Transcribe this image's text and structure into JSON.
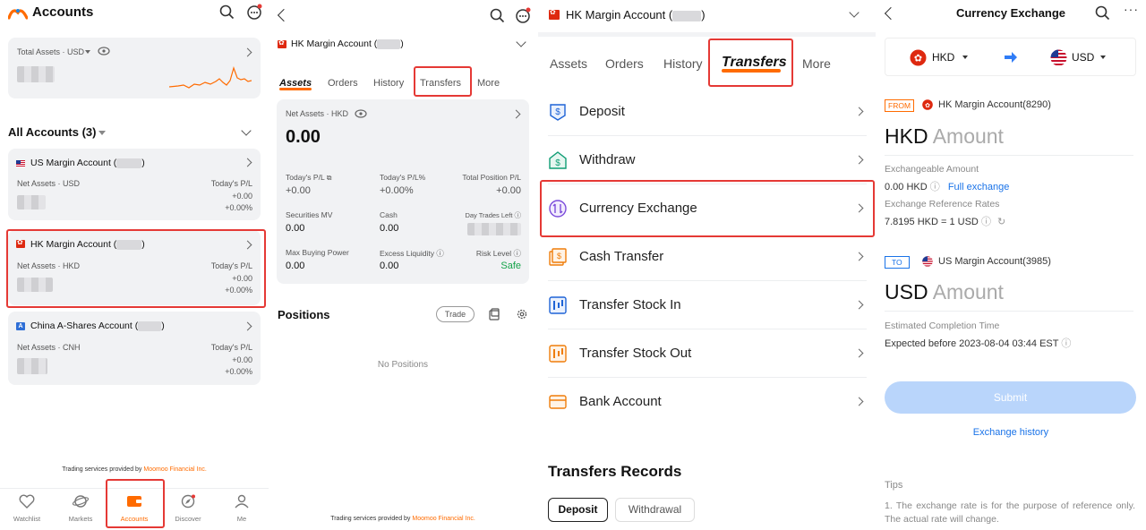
{
  "panel1": {
    "title": "Accounts",
    "total_assets_label": "Total Assets · USD",
    "all_accounts_label": "All Accounts (3)",
    "accounts": [
      {
        "name": "US Margin Account (",
        "close": ")",
        "net_label": "Net Assets · USD",
        "pl_label": "Today's P/L",
        "pl_value": "+0.00",
        "pl_pct": "+0.00%"
      },
      {
        "name": "HK Margin Account (",
        "close": ")",
        "net_label": "Net Assets · HKD",
        "pl_label": "Today's P/L",
        "pl_value": "+0.00",
        "pl_pct": "+0.00%"
      },
      {
        "name": "China A-Shares Account (",
        "close": ")",
        "net_label": "Net Assets · CNH",
        "pl_label": "Today's P/L",
        "pl_value": "+0.00",
        "pl_pct": "+0.00%"
      }
    ],
    "footer_prefix": "Trading services provided by ",
    "footer_brand": "Moomoo Financial Inc.",
    "nav": [
      "Watchlist",
      "Markets",
      "Accounts",
      "Discover",
      "Me"
    ]
  },
  "panel2": {
    "account_name": "HK Margin Account (",
    "account_close": ")",
    "tabs": [
      "Assets",
      "Orders",
      "History",
      "Transfers",
      "More"
    ],
    "net_assets_label": "Net Assets · HKD",
    "net_assets_value": "0.00",
    "stats": [
      {
        "label": "Today's P/L",
        "value": "+0.00"
      },
      {
        "label": "Today's P/L%",
        "value": "+0.00%"
      },
      {
        "label": "Total Position P/L",
        "value": "+0.00"
      },
      {
        "label": "Securities MV",
        "value": "0.00"
      },
      {
        "label": "Cash",
        "value": "0.00"
      },
      {
        "label": "Day Trades Left",
        "value": ""
      },
      {
        "label": "Max Buying Power",
        "value": "0.00"
      },
      {
        "label": "Excess Liquidity",
        "value": "0.00"
      },
      {
        "label": "Risk Level",
        "value": "Safe"
      }
    ],
    "positions_title": "Positions",
    "trade_button": "Trade",
    "no_positions": "No Positions",
    "footer_prefix": "Trading services provided by ",
    "footer_brand": "Moomoo Financial Inc."
  },
  "panel3": {
    "account_name": "HK Margin Account (",
    "account_close": ")",
    "tabs": [
      "Assets",
      "Orders",
      "History",
      "Transfers",
      "More"
    ],
    "rows": [
      "Deposit",
      "Withdraw",
      "Currency Exchange",
      "Cash Transfer",
      "Transfer Stock In",
      "Transfer Stock Out",
      "Bank Account"
    ],
    "records_title": "Transfers Records",
    "record_tabs": [
      "Deposit",
      "Withdrawal"
    ]
  },
  "panel4": {
    "title": "Currency Exchange",
    "from_currency": "HKD",
    "to_currency": "USD",
    "from_tag": "FROM",
    "from_account": "HK Margin Account(8290)",
    "from_amount_currency": "HKD",
    "amount_placeholder": "Amount",
    "exchangeable_label": "Exchangeable Amount",
    "exchangeable_value": "0.00 HKD",
    "full_exchange": "Full exchange",
    "rate_label": "Exchange Reference Rates",
    "rate_value": "7.8195 HKD = 1 USD",
    "to_tag": "TO",
    "to_account": "US Margin Account(3985)",
    "to_amount_currency": "USD",
    "completion_label": "Estimated Completion Time",
    "completion_value": "Expected before 2023-08-04 03:44 EST",
    "submit": "Submit",
    "history_link": "Exchange history",
    "tips_title": "Tips",
    "tips_text": "1.  The exchange rate is for the purpose of reference only. The actual rate will change."
  },
  "colors": {
    "accent": "#ff6b00",
    "highlight": "#e53935",
    "link": "#1a73e8",
    "positive": "#16a34a"
  }
}
